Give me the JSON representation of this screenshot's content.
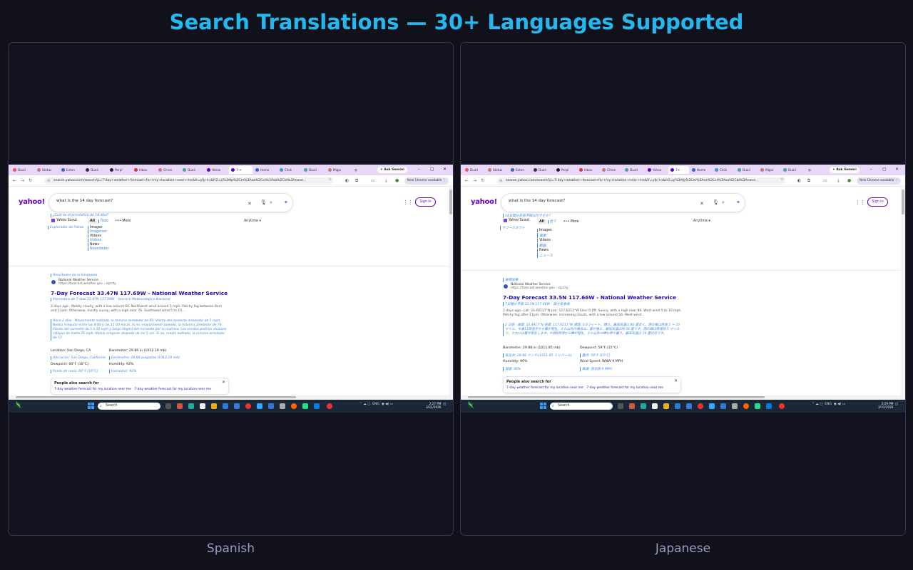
{
  "title": "Search Translations — 30+ Languages Supported",
  "panels": [
    {
      "caption": "Spanish",
      "tabs": [
        "Duali",
        "Status",
        "Exten",
        "Duali",
        "Perpl",
        "Inbox",
        "Chron",
        "Duali",
        "Yahoo",
        "7-",
        "Home",
        "Click",
        "Duali",
        "Migai"
      ],
      "gemini": "Ask Gemini",
      "url": "search.yahoo.com/search?p=7-day+weather+forecast+for+my+location+near+me&fr=yfp-t-s&fr2=p%3Afp%2Cm%3Asa%2Cct%3Asa%2Ckt%3Anone...",
      "new_chrome": "New Chrome available",
      "logo": "yahoo!",
      "query": "what is the 14 day forecast?",
      "query_tr": "¿Cuál es el pronóstico de 14 días?",
      "sign_in": "Sign in",
      "scout": "Yahoo Scout",
      "scout_tr": "Explorador de Yahoo",
      "filters": [
        {
          "label": "All",
          "tr": "Todo"
        },
        {
          "label": "Images",
          "tr": "Imágenes"
        },
        {
          "label": "Videos",
          "tr": "Videos"
        },
        {
          "label": "News",
          "tr": "Novedades"
        }
      ],
      "more": "••• More",
      "anytime": "Anytime ▾",
      "results_tr": "Resultados de la búsqueda",
      "source_name": "National Weather Service",
      "source_url": "https://forecast.weather.gov › zipcity",
      "result_title": "7-Day Forecast 33.47N 117.69W - National Weather Service",
      "result_title_tr": "Pronóstico de 7 días 33.47N 117.69W - Servicio Meteorológico Nacional",
      "snippet": "2 days ago · Mostly cloudy, with a low around 60. Northwest wind around 5 mph. Patchy fog between 8am and 11am. Otherwise, mostly sunny, with a high near 76. Southwest wind 5 to 10...",
      "snippet_tr": "Hace 2 días · Mayormente nublado, la mínima alrededor de 60. Viento del noroeste alrededor de 5 mph. Niebla irregular entre las 8:00 y las 11:00 horas. Si no, mayormente soleado, la máxima alrededor de 76. Viento del suroeste de 5 a 10 mph y luego llegará del noroeste por la mañana. Los vientos podrían alcanzar ráfagas de hasta 20 mph. Niebla irregular después de las 5 am. Si no, medio nublado, la mínima alrededor de 57.",
      "kv": [
        {
          "text": "Location: San Diego, CA",
          "tr": "Ubicación: San Diego, California"
        },
        {
          "text": "Barometer: 29.89 in (1012.19 mb)",
          "tr": "Barómetro: 29,89 pulgadas (1012,19 mb)"
        },
        {
          "text": "Dewpoint: 60°F (16°C)",
          "tr": "Punto de rocío: 60°F (16°C)"
        },
        {
          "text": "Humidity: 92%",
          "tr": "Humedad: 92%"
        }
      ],
      "people_also": "People also search for",
      "pas_links": [
        "7-day weather forecast for my location near me",
        "7-day weather forecast for my location near me"
      ],
      "taskbar_search": "Search",
      "tray": "ENG",
      "time": "2:27 PM",
      "date": "3/31/2026"
    },
    {
      "caption": "Japanese",
      "tabs": [
        "Duali",
        "Status",
        "Exten",
        "Duali",
        "Perpl",
        "Inbox",
        "Chron",
        "Duali",
        "Yahoo",
        "7",
        "Home",
        "Click",
        "Duali",
        "Migai",
        "Duali"
      ],
      "gemini": "Ask Gemini",
      "url": "search.yahoo.com/search?p=7-day+weather+forecast+for+my+location+near+me&fr=yfp-t-s&fr2=p%3Afp%2Cm%3Asa%2Cct%3Asa%2Ckt%3Anone...",
      "new_chrome": "New Chrome available",
      "logo": "yahoo!",
      "query": "what is the 14 day forecast?",
      "query_tr": "14日間の天気予報は何ですか？",
      "sign_in": "Sign in",
      "scout": "Yahoo Scout",
      "scout_tr": "ヤフースカウト",
      "filters": [
        {
          "label": "All",
          "tr": "全て"
        },
        {
          "label": "Images",
          "tr": "画像"
        },
        {
          "label": "Videos",
          "tr": "動画"
        },
        {
          "label": "News",
          "tr": "ニュース"
        }
      ],
      "more": "••• More",
      "anytime": "Anytime ▾",
      "results_tr": "検索結果",
      "source_name": "National Weather Service",
      "source_url": "https://forecast.weather.gov › zipcity",
      "result_title": "7-Day Forecast 33.5N 117.66W - National Weather Service",
      "result_title_tr": "7日間の予報 33.5N 117.66W - 国立気象局",
      "snippet": "2 days ago · Lat: 33.49117°N Lon: 117.6211°W Elev: 0.0ft. Sunny, with a high near 80. West wind 5 to 10 mph. Patchy fog after 11pm. Otherwise, increasing clouds, with a low around 56. West wind...",
      "snippet_tr": "2 日前 · 緯度: 33.4917°N 経度: 117.6211°W 標高: 0.0フィート。晴れ、最高気温は 80 度近く。西の風は時速 5 ～ 10 マイル。午後11時過ぎから霧が発生。それ以外の場合は、雲が増え、最低気温は約 56 度です。西の風は時速約 5 マイルで、夕方には霧が発生します。午前8時頃から霧が発生。それ以外は晴れ時々曇り。最高気温は 74 度付近です。",
      "kv": [
        {
          "text": "Barometer: 29.88 in (1011.85 mb)",
          "tr": "気圧計: 29.88 インチ (1011.85 ミリバール)"
        },
        {
          "text": "Dewpoint: 59°F (15°C)",
          "tr": "露点: 59°F (15°C)"
        },
        {
          "text": "Humidity: 90%",
          "tr": "湿度: 90%"
        },
        {
          "text": "Wind Speed: WNW 9 MPH",
          "tr": "風速: 西北西 9 MPH"
        }
      ],
      "people_also": "People also search for",
      "pas_links": [
        "7-day weather forecast for my location near me",
        "7-day weather forecast for my location near me"
      ],
      "taskbar_search": "Search",
      "tray": "ENG",
      "time": "2:29 PM",
      "date": "3/31/2026"
    }
  ],
  "colors": {
    "accent": "#22b8f0",
    "translation": "#3a86e6",
    "yahoo": "#5f01d1",
    "link": "#1a0dab"
  }
}
